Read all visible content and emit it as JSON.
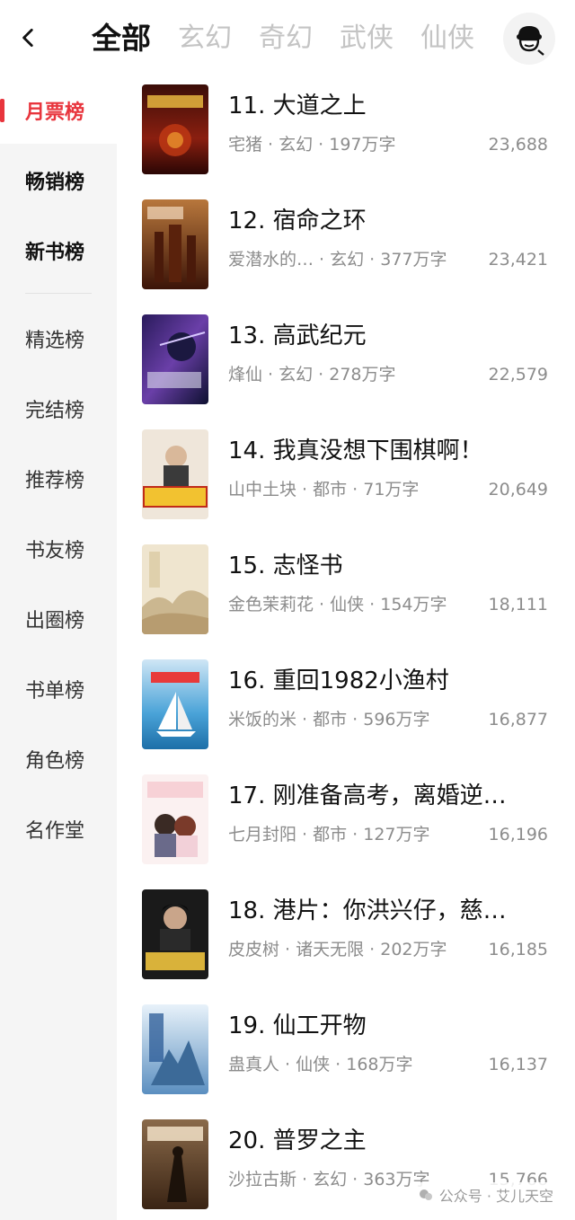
{
  "header": {
    "tabs": [
      {
        "label": "全部",
        "active": true
      },
      {
        "label": "玄幻",
        "active": false
      },
      {
        "label": "奇幻",
        "active": false
      },
      {
        "label": "武侠",
        "active": false
      },
      {
        "label": "仙侠",
        "active": false
      }
    ],
    "back_icon": "chevron-left-icon",
    "avatar_icon": "reader-avatar-icon"
  },
  "sidebar": {
    "items": [
      {
        "label": "月票榜"
      },
      {
        "label": "畅销榜"
      },
      {
        "label": "新书榜"
      },
      {
        "label": "精选榜"
      },
      {
        "label": "完结榜"
      },
      {
        "label": "推荐榜"
      },
      {
        "label": "书友榜"
      },
      {
        "label": "出圈榜"
      },
      {
        "label": "书单榜"
      },
      {
        "label": "角色榜"
      },
      {
        "label": "名作堂"
      }
    ],
    "active_index": 0
  },
  "books": [
    {
      "title": "11. 大道之上",
      "meta": "宅猪 · 玄幻 · 197万字",
      "votes": "23,688"
    },
    {
      "title": "12. 宿命之环",
      "meta": "爱潜水的… · 玄幻 · 377万字",
      "votes": "23,421"
    },
    {
      "title": "13. 高武纪元",
      "meta": "烽仙 · 玄幻 · 278万字",
      "votes": "22,579"
    },
    {
      "title": "14. 我真没想下围棋啊！",
      "meta": "山中土块 · 都市 · 71万字",
      "votes": "20,649"
    },
    {
      "title": "15. 志怪书",
      "meta": "金色茉莉花 · 仙侠 · 154万字",
      "votes": "18,111"
    },
    {
      "title": "16. 重回1982小渔村",
      "meta": "米饭的米 · 都市 · 596万字",
      "votes": "16,877"
    },
    {
      "title": "17. 刚准备高考，离婚逆…",
      "meta": "七月封阳 · 都市 · 127万字",
      "votes": "16,196"
    },
    {
      "title": "18. 港片：你洪兴仔，慈…",
      "meta": "皮皮树 · 诸天无限 · 202万字",
      "votes": "16,185"
    },
    {
      "title": "19. 仙工开物",
      "meta": "蛊真人 · 仙侠 · 168万字",
      "votes": "16,137"
    },
    {
      "title": "20. 普罗之主",
      "meta": "沙拉古斯 · 玄幻 · 363万字",
      "votes": "15,766"
    }
  ],
  "watermark": {
    "text": "公众号 · 艾儿天空"
  },
  "colors": {
    "accent": "#e8353d",
    "sidebar_bg": "#f5f5f5",
    "meta_text": "#8c8c8c"
  }
}
